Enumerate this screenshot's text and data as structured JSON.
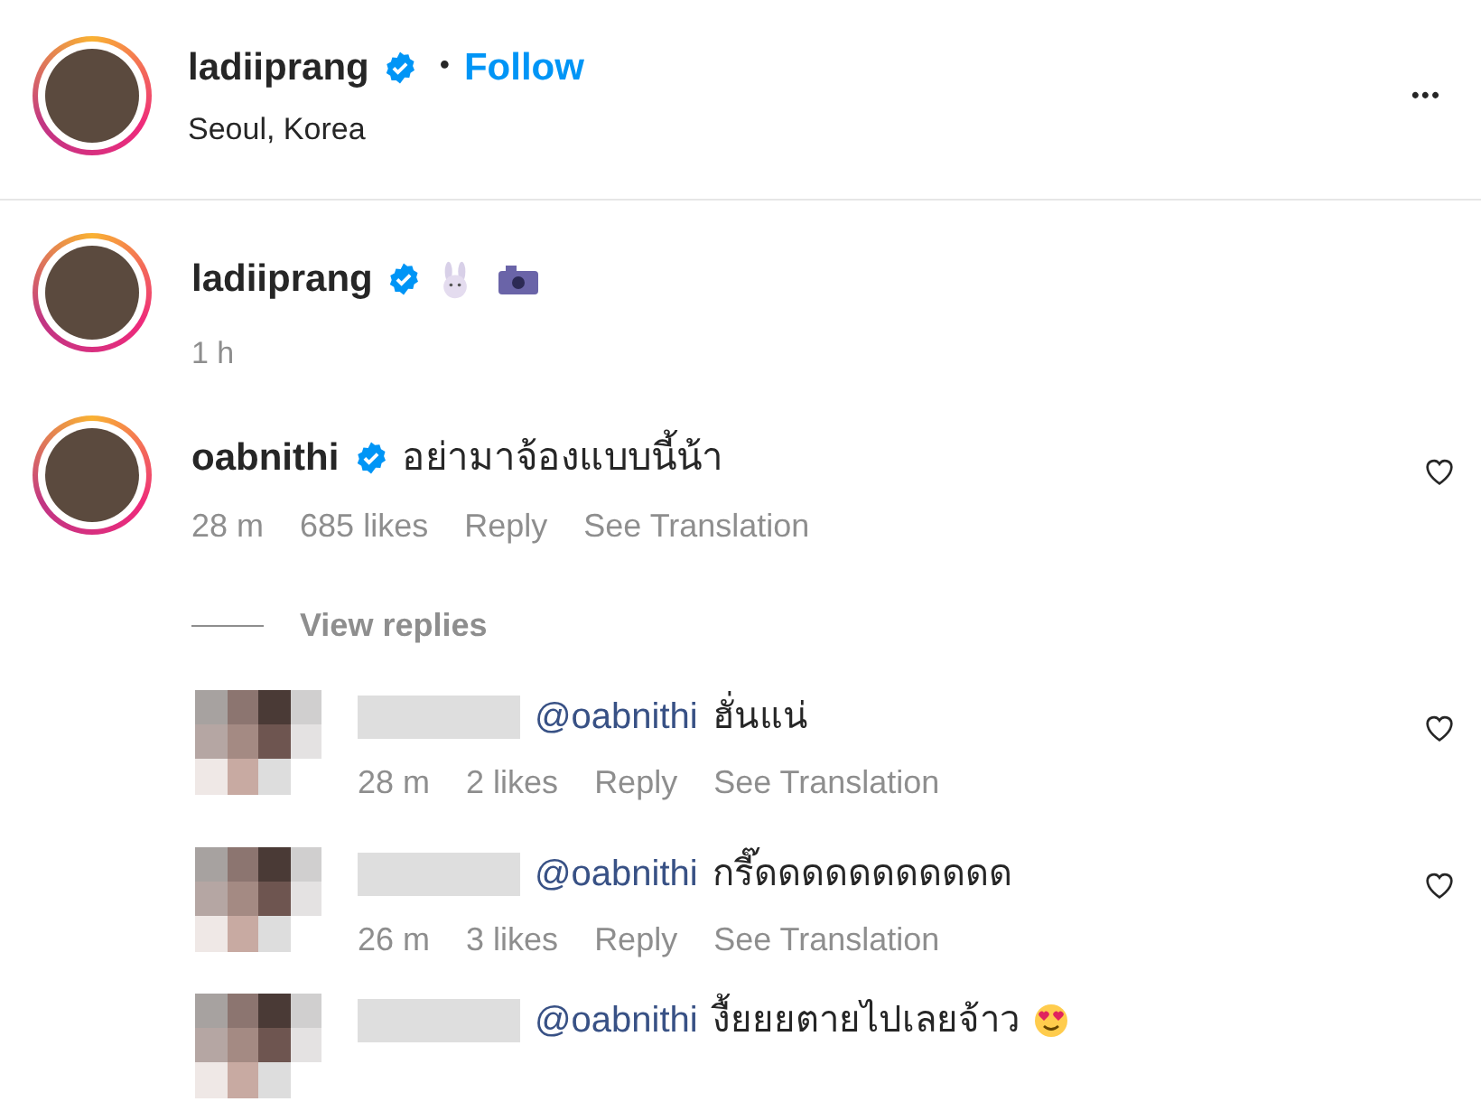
{
  "header": {
    "username": "ladiiprang",
    "verified": true,
    "separator": "•",
    "follow": "Follow",
    "location": "Seoul, Korea",
    "more": "•••"
  },
  "caption": {
    "username": "ladiiprang",
    "verified": true,
    "time": "1 h"
  },
  "comment": {
    "username": "oabnithi",
    "verified": true,
    "text": "อย่ามาจ้องแบบนี้น้า",
    "time": "28 m",
    "likes": "685 likes",
    "reply": "Reply",
    "translate": "See Translation",
    "liked": false,
    "view_replies": "View replies"
  },
  "replies": [
    {
      "mention": "@oabnithi",
      "text": "ฮั่นแน่",
      "time": "28 m",
      "likes": "2 likes",
      "reply": "Reply",
      "translate": "See Translation",
      "liked": false
    },
    {
      "mention": "@oabnithi",
      "text": "กรี๊ดดดดดดดดดดด",
      "time": "26 m",
      "likes": "3 likes",
      "reply": "Reply",
      "translate": "See Translation",
      "liked": false
    },
    {
      "mention": "@oabnithi",
      "text": "งื้ยยยตายไปเลยจ้าว"
    }
  ]
}
